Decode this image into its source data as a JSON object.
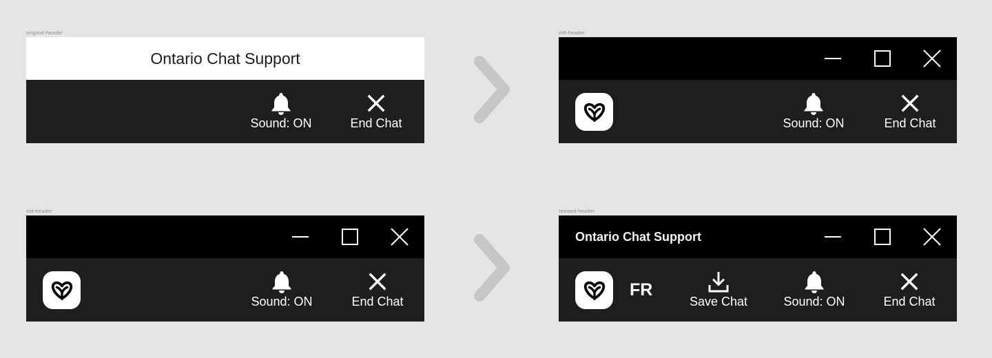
{
  "frames": {
    "original": {
      "label": "original-header",
      "title": "Ontario Chat Support",
      "sound_label": "Sound: ON",
      "end_chat_label": "End Chat"
    },
    "old_a": {
      "label": "old-header",
      "sound_label": "Sound: ON",
      "end_chat_label": "End Chat"
    },
    "old_b": {
      "label": "old-header",
      "sound_label": "Sound: ON",
      "end_chat_label": "End Chat"
    },
    "revised": {
      "label": "revised-header",
      "title": "Ontario Chat Support",
      "language_label": "FR",
      "save_chat_label": "Save Chat",
      "sound_label": "Sound: ON",
      "end_chat_label": "End Chat"
    }
  },
  "icons": {
    "bell": "bell-icon",
    "close": "close-icon",
    "download": "download-icon",
    "minimize": "minimize-icon",
    "maximize": "maximize-icon",
    "window_close": "window-close-icon",
    "logo": "ontario-trillium-logo",
    "arrow": "chevron-right-icon"
  },
  "colors": {
    "canvas": "#e5e5e5",
    "titlebar_black": "#000000",
    "toolbar": "#1e1e1e",
    "titlebar_white": "#ffffff",
    "arrow": "#c6c6c6"
  }
}
